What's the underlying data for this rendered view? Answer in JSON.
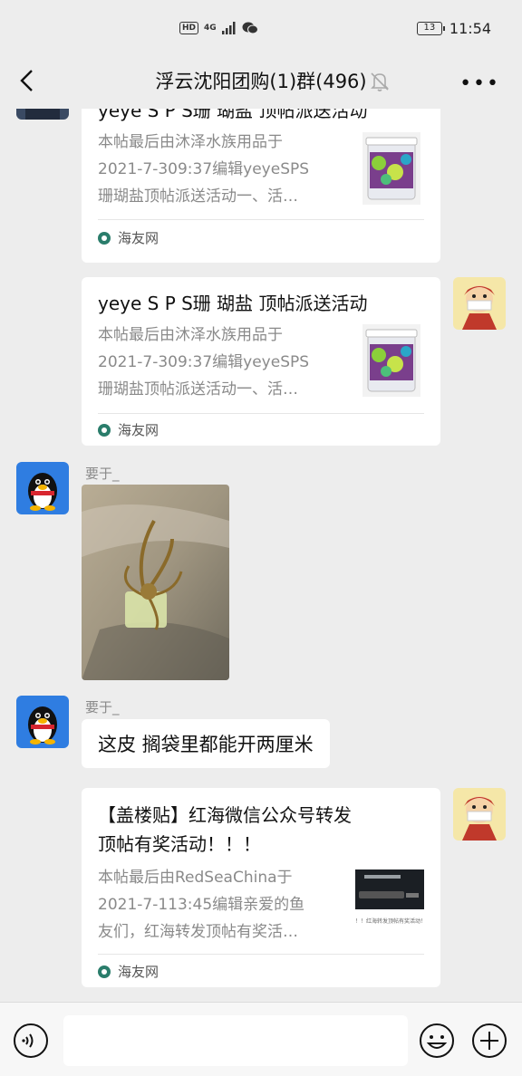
{
  "status_bar": {
    "hd": "HD",
    "network": "4G",
    "battery": "13",
    "time": "11:54"
  },
  "header": {
    "title": "浮云沈阳团购(1)群(496)"
  },
  "messages": [
    {
      "type": "link_card",
      "side": "left",
      "title": "yeye S P S珊 瑚盐 顶帖派送活动",
      "desc_lines": [
        "本帖最后由沐泽水族用品于",
        "2021-7-309:37编辑yeyeSPS",
        "珊瑚盐顶帖派送活动一、活…"
      ],
      "source": "海友网"
    },
    {
      "type": "link_card",
      "side": "right",
      "title": "yeye S P S珊 瑚盐 顶帖派送活动",
      "desc_lines": [
        "本帖最后由沐泽水族用品于",
        "2021-7-309:37编辑yeyeSPS",
        "珊瑚盐顶帖派送活动一、活…"
      ],
      "source": "海友网"
    },
    {
      "type": "image",
      "side": "left",
      "sender": "要于_"
    },
    {
      "type": "text",
      "side": "left",
      "sender": "要于_",
      "text": "这皮 搁袋里都能开两厘米"
    },
    {
      "type": "link_card",
      "side": "right",
      "title_lines": [
        "【盖楼贴】红海微信公众号转发",
        "顶帖有奖活动！！！"
      ],
      "desc_lines": [
        "本帖最后由RedSeaChina于",
        "2021-7-113:45编辑亲爱的鱼",
        "友们，红海转发顶帖有奖活…"
      ],
      "thumb_caption": "！！红海转发顶帖有奖活动！",
      "source": "海友网"
    }
  ],
  "colors": {
    "background": "#ededed",
    "bubble": "#ffffff",
    "secondary_text": "#8a8a8a"
  },
  "icons": [
    "back-icon",
    "mute-bell-icon",
    "more-icon",
    "voice-icon",
    "emoji-icon",
    "plus-icon"
  ]
}
